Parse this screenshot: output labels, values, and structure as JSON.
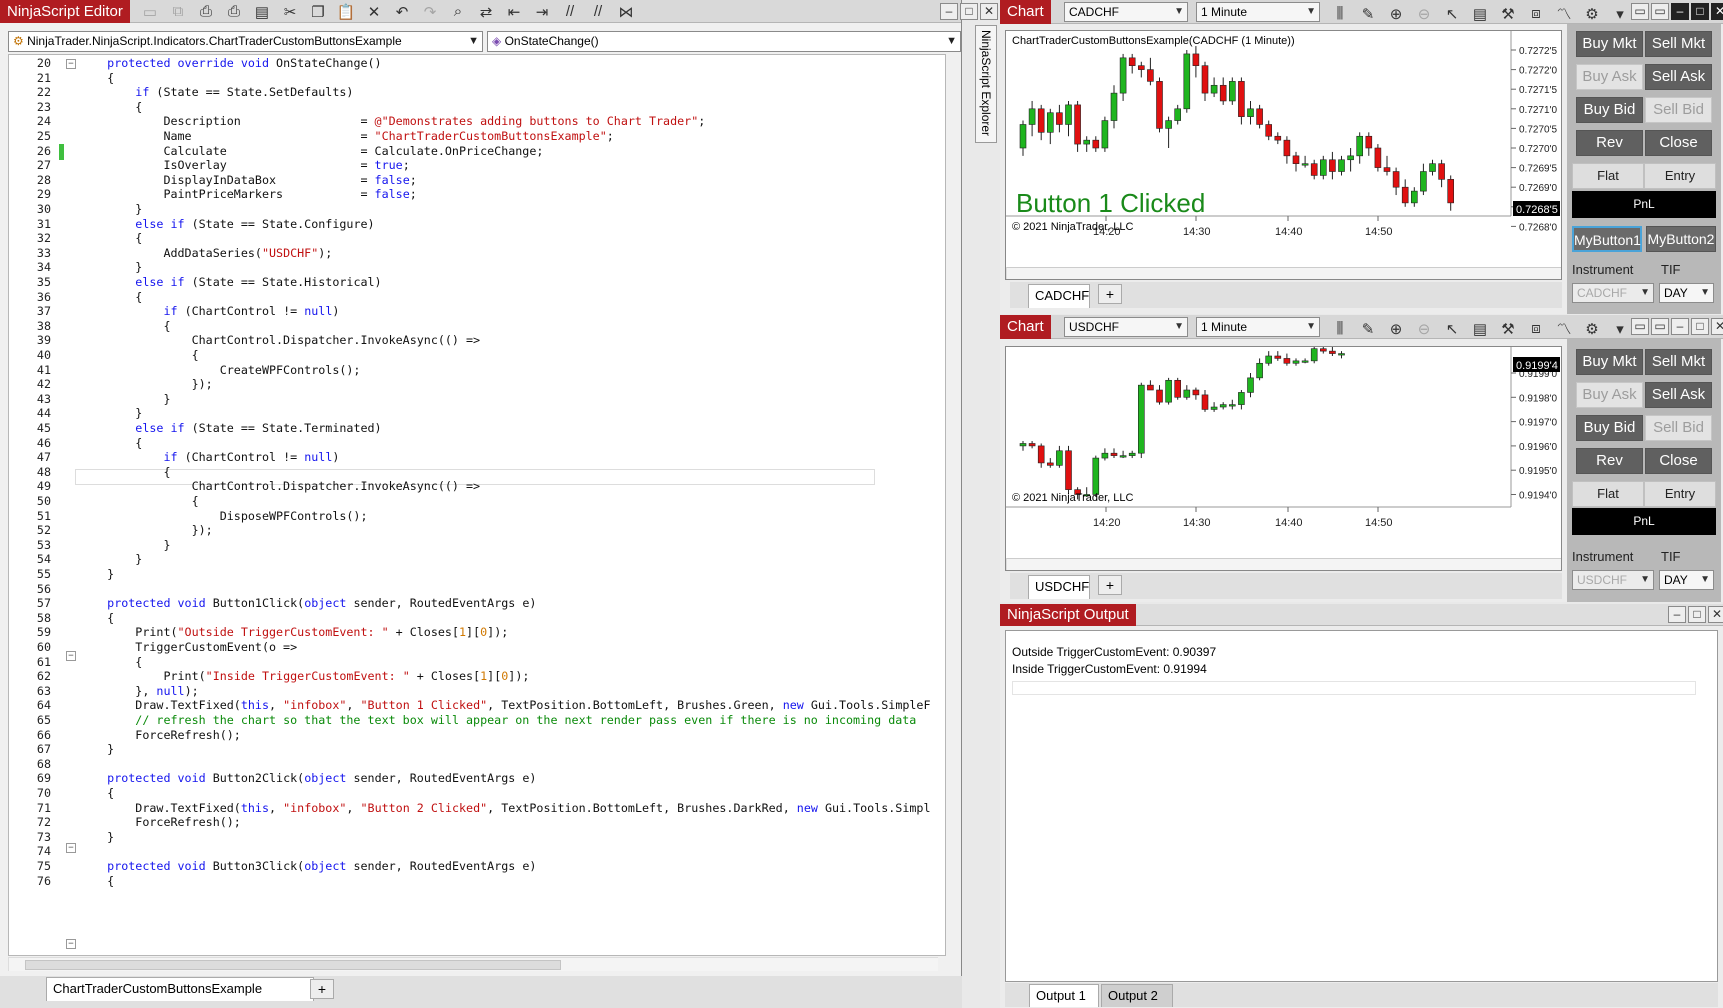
{
  "editor": {
    "title": "NinjaScript Editor",
    "class_dropdown": "NinjaTrader.NinjaScript.Indicators.ChartTraderCustomButtonsExample",
    "method_dropdown": "OnStateChange()",
    "explorer_label": "NinjaScript Explorer",
    "file_tab": "ChartTraderCustomButtonsExample",
    "add_tab": "+",
    "code_lines": [
      {
        "n": "20",
        "html": "    <span class=\"kw\">protected override void</span> OnStateChange()"
      },
      {
        "n": "21",
        "html": "    {"
      },
      {
        "n": "22",
        "html": "        <span class=\"kw\">if</span> (State == State.SetDefaults)"
      },
      {
        "n": "23",
        "html": "        {"
      },
      {
        "n": "24",
        "html": "            Description                 = <span class=\"st\">@\"Demonstrates adding buttons to Chart Trader\"</span>;"
      },
      {
        "n": "25",
        "html": "            Name                        = <span class=\"st\">\"ChartTraderCustomButtonsExample\"</span>;"
      },
      {
        "n": "26",
        "html": "            Calculate                   = Calculate.OnPriceChange;"
      },
      {
        "n": "27",
        "html": "            IsOverlay                   = <span class=\"kw\">true</span>;"
      },
      {
        "n": "28",
        "html": "            DisplayInDataBox            = <span class=\"kw\">false</span>;"
      },
      {
        "n": "29",
        "html": "            PaintPriceMarkers           = <span class=\"kw\">false</span>;"
      },
      {
        "n": "30",
        "html": "        }"
      },
      {
        "n": "31",
        "html": "        <span class=\"kw\">else if</span> (State == State.Configure)"
      },
      {
        "n": "32",
        "html": "        {"
      },
      {
        "n": "33",
        "html": "            AddDataSeries(<span class=\"st\">\"USDCHF\"</span>);"
      },
      {
        "n": "34",
        "html": "        }"
      },
      {
        "n": "35",
        "html": "        <span class=\"kw\">else if</span> (State == State.Historical)"
      },
      {
        "n": "36",
        "html": "        {"
      },
      {
        "n": "37",
        "html": "            <span class=\"kw\">if</span> (ChartControl != <span class=\"kw\">null</span>)"
      },
      {
        "n": "38",
        "html": "            {"
      },
      {
        "n": "39",
        "html": "                ChartControl.Dispatcher.InvokeAsync(() =>"
      },
      {
        "n": "40",
        "html": "                {"
      },
      {
        "n": "41",
        "html": "                    CreateWPFControls();"
      },
      {
        "n": "42",
        "html": "                });"
      },
      {
        "n": "43",
        "html": "            }"
      },
      {
        "n": "44",
        "html": "        }"
      },
      {
        "n": "45",
        "html": "        <span class=\"kw\">else if</span> (State == State.Terminated)"
      },
      {
        "n": "46",
        "html": "        {"
      },
      {
        "n": "47",
        "html": "            <span class=\"kw\">if</span> (ChartControl != <span class=\"kw\">null</span>)"
      },
      {
        "n": "48",
        "html": "            {"
      },
      {
        "n": "49",
        "html": "                ChartControl.Dispatcher.InvokeAsync(() =>"
      },
      {
        "n": "50",
        "html": "                {"
      },
      {
        "n": "51",
        "html": "                    DisposeWPFControls();"
      },
      {
        "n": "52",
        "html": "                });"
      },
      {
        "n": "53",
        "html": "            }"
      },
      {
        "n": "54",
        "html": "        }"
      },
      {
        "n": "55",
        "html": "    }"
      },
      {
        "n": "56",
        "html": ""
      },
      {
        "n": "57",
        "html": "    <span class=\"kw\">protected void</span> Button1Click(<span class=\"kw\">object</span> sender, RoutedEventArgs e)"
      },
      {
        "n": "58",
        "html": "    {"
      },
      {
        "n": "59",
        "html": "        Print(<span class=\"st\">\"Outside TriggerCustomEvent: \"</span> + Closes[<span class=\"num\">1</span>][<span class=\"num\">0</span>]);"
      },
      {
        "n": "60",
        "html": "        TriggerCustomEvent(o =>"
      },
      {
        "n": "61",
        "html": "        {"
      },
      {
        "n": "62",
        "html": "            Print(<span class=\"st\">\"Inside TriggerCustomEvent: \"</span> + Closes[<span class=\"num\">1</span>][<span class=\"num\">0</span>]);"
      },
      {
        "n": "63",
        "html": "        }, <span class=\"kw\">null</span>);"
      },
      {
        "n": "64",
        "html": "        Draw.TextFixed(<span class=\"kw\">this</span>, <span class=\"st\">\"infobox\"</span>, <span class=\"st\">\"Button 1 Clicked\"</span>, TextPosition.BottomLeft, Brushes.Green, <span class=\"kw\">new</span> Gui.Tools.SimpleF"
      },
      {
        "n": "65",
        "html": "        <span class=\"cm\">// refresh the chart so that the text box will appear on the next render pass even if there is no incoming data</span>"
      },
      {
        "n": "66",
        "html": "        ForceRefresh();"
      },
      {
        "n": "67",
        "html": "    }"
      },
      {
        "n": "68",
        "html": ""
      },
      {
        "n": "69",
        "html": "    <span class=\"kw\">protected void</span> Button2Click(<span class=\"kw\">object</span> sender, RoutedEventArgs e)"
      },
      {
        "n": "70",
        "html": "    {"
      },
      {
        "n": "71",
        "html": "        Draw.TextFixed(<span class=\"kw\">this</span>, <span class=\"st\">\"infobox\"</span>, <span class=\"st\">\"Button 2 Clicked\"</span>, TextPosition.BottomLeft, Brushes.DarkRed, <span class=\"kw\">new</span> Gui.Tools.Simpl"
      },
      {
        "n": "72",
        "html": "        ForceRefresh();"
      },
      {
        "n": "73",
        "html": "    }"
      },
      {
        "n": "74",
        "html": ""
      },
      {
        "n": "75",
        "html": "    <span class=\"kw\">protected void</span> Button3Click(<span class=\"kw\">object</span> sender, RoutedEventArgs e)"
      },
      {
        "n": "76",
        "html": "    {"
      }
    ]
  },
  "chart1": {
    "tag": "Chart",
    "instrument": "CADCHF",
    "interval": "1 Minute",
    "header": "ChartTraderCustomButtonsExample(CADCHF (1 Minute))",
    "overlay_text": "Button 1 Clicked",
    "overlay_color": "#1a8a1a",
    "copyright": "© 2021 NinjaTrader, LLC",
    "price_labels": [
      "0.7272'5",
      "0.7272'0",
      "0.7271'5",
      "0.7271'0",
      "0.7270'5",
      "0.7270'0",
      "0.7269'5",
      "0.7269'0",
      "0.7268'5",
      "0.7268'0"
    ],
    "current_price": "0.7268'5",
    "time_labels": [
      "14:20",
      "14:30",
      "14:40",
      "14:50"
    ],
    "tab": "CADCHF",
    "buttons": {
      "buy_mkt": "Buy Mkt",
      "sell_mkt": "Sell Mkt",
      "buy_ask": "Buy Ask",
      "sell_ask": "Sell Ask",
      "buy_bid": "Buy Bid",
      "sell_bid": "Sell Bid",
      "rev": "Rev",
      "close": "Close",
      "flat": "Flat",
      "entry": "Entry",
      "pnl": "PnL",
      "mybutton1": "MyButton1",
      "mybutton2": "MyButton2"
    },
    "instrument_label": "Instrument",
    "tif_label": "TIF",
    "instrument_value": "CADCHF",
    "tif_value": "DAY"
  },
  "chart2": {
    "tag": "Chart",
    "instrument": "USDCHF",
    "interval": "1 Minute",
    "copyright": "© 2021 NinjaTrader, LLC",
    "price_labels": [
      "0.9199'0",
      "0.9198'0",
      "0.9197'0",
      "0.9196'0",
      "0.9195'0",
      "0.9194'0"
    ],
    "current_price": "0.9199'4",
    "time_labels": [
      "14:20",
      "14:30",
      "14:40",
      "14:50"
    ],
    "tab": "USDCHF",
    "buttons": {
      "buy_mkt": "Buy Mkt",
      "sell_mkt": "Sell Mkt",
      "buy_ask": "Buy Ask",
      "sell_ask": "Sell Ask",
      "buy_bid": "Buy Bid",
      "sell_bid": "Sell Bid",
      "rev": "Rev",
      "close": "Close",
      "flat": "Flat",
      "entry": "Entry",
      "pnl": "PnL"
    },
    "instrument_label": "Instrument",
    "tif_label": "TIF",
    "instrument_value": "USDCHF",
    "tif_value": "DAY"
  },
  "output": {
    "title": "NinjaScript Output",
    "lines": [
      "Outside TriggerCustomEvent: 0.90397",
      "Inside TriggerCustomEvent: 0.91994"
    ],
    "tab1": "Output 1",
    "tab2": "Output 2"
  },
  "colors": {
    "accent": "#b01c21",
    "up_candle": "#1fb51f",
    "down_candle": "#e01010"
  }
}
